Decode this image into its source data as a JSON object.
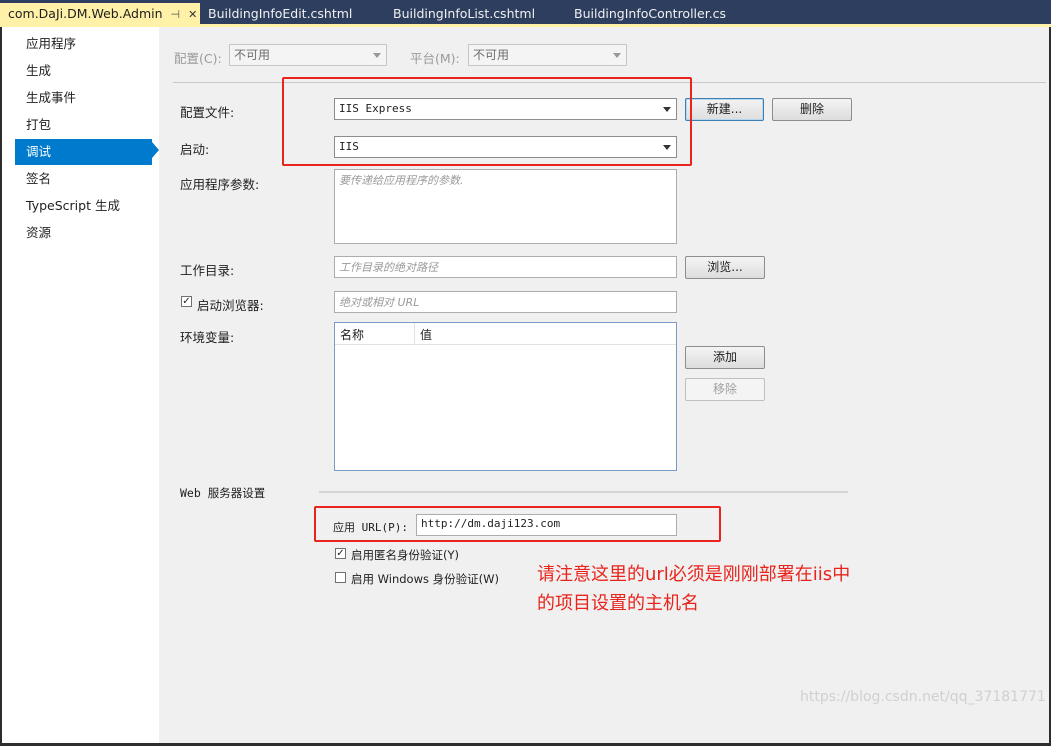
{
  "tabs": [
    {
      "label": "com.DaJi.DM.Web.Admin",
      "pin": "⊣",
      "close": "✕"
    },
    {
      "label": "BuildingInfoEdit.cshtml"
    },
    {
      "label": "BuildingInfoList.cshtml"
    },
    {
      "label": "BuildingInfoController.cs"
    }
  ],
  "sidebar": {
    "items": [
      {
        "label": "应用程序"
      },
      {
        "label": "生成"
      },
      {
        "label": "生成事件"
      },
      {
        "label": "打包"
      },
      {
        "label": "调试",
        "selected": true
      },
      {
        "label": "签名"
      },
      {
        "label": "TypeScript 生成"
      },
      {
        "label": "资源"
      }
    ]
  },
  "config": {
    "config_label": "配置(C):",
    "config_value": "不可用",
    "platform_label": "平台(M):",
    "platform_value": "不可用"
  },
  "profile": {
    "label": "配置文件:",
    "value": "IIS Express",
    "new_button": "新建...",
    "delete_button": "删除"
  },
  "launch": {
    "label": "启动:",
    "value": "IIS"
  },
  "app_args": {
    "label": "应用程序参数:",
    "placeholder": "要传递给应用程序的参数."
  },
  "work_dir": {
    "label": "工作目录:",
    "placeholder": "工作目录的绝对路径",
    "browse_button": "浏览..."
  },
  "browser": {
    "label": "启动浏览器:",
    "checked": true,
    "placeholder": "绝对或相对 URL"
  },
  "env": {
    "label": "环境变量:",
    "col_name": "名称",
    "col_value": "值",
    "add_button": "添加",
    "remove_button": "移除"
  },
  "web_server": {
    "section_label": "Web 服务器设置",
    "url_label": "应用 URL(P):",
    "url_value": "http://dm.daji123.com",
    "anon_auth_label": "启用匿名身份验证(Y)",
    "anon_auth_checked": true,
    "win_auth_label": "启用 Windows 身份验证(W)",
    "win_auth_checked": false
  },
  "annotation": {
    "line1": "请注意这里的url必须是刚刚部署在iis中",
    "line2": "的项目设置的主机名",
    "color": "#e8241c"
  },
  "watermark": "https://blog.csdn.net/qq_37181771",
  "colors": {
    "accent": "#007acc",
    "active_tab": "#fff1a8",
    "tab_bar": "#2d3e5e"
  }
}
